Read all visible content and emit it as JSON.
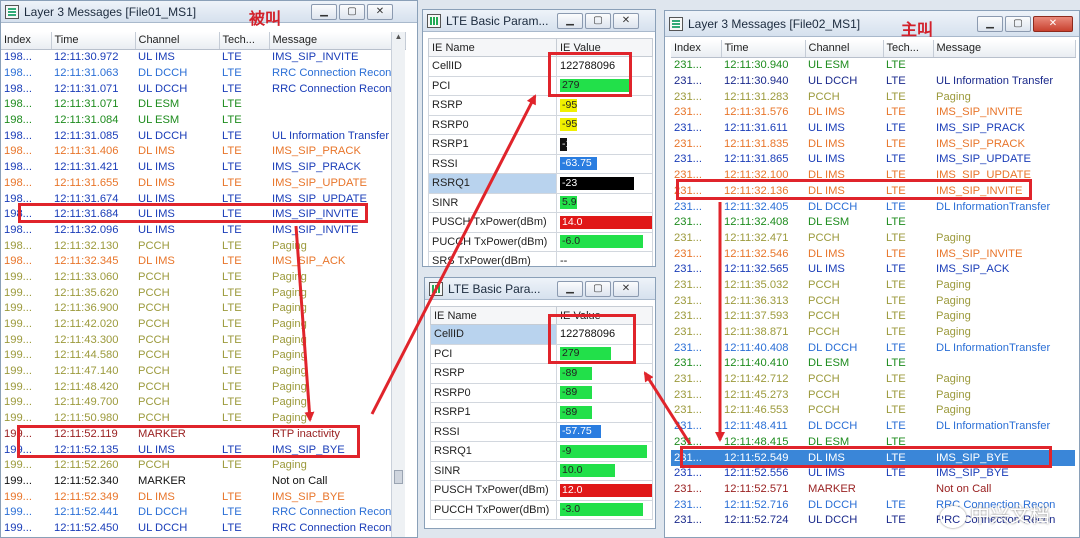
{
  "colors": {
    "accent_red": "#e0242b",
    "selected_row": "#3a86d8"
  },
  "window_left": {
    "title": "Layer 3 Messages [File01_MS1]",
    "note": "被叫",
    "columns": [
      "Index",
      "Time",
      "Channel",
      "Tech...",
      "Message"
    ],
    "rows": [
      {
        "c": "blue",
        "cells": [
          "198...",
          "12:11:30.972",
          "UL IMS",
          "LTE",
          "IMS_SIP_INVITE"
        ]
      },
      {
        "c": "lblue",
        "cells": [
          "198...",
          "12:11:31.063",
          "DL DCCH",
          "LTE",
          "RRC Connection Reconf"
        ]
      },
      {
        "c": "blue",
        "cells": [
          "198...",
          "12:11:31.071",
          "UL DCCH",
          "LTE",
          "RRC Connection Reconf"
        ]
      },
      {
        "c": "green",
        "cells": [
          "198...",
          "12:11:31.071",
          "DL ESM",
          "LTE",
          ""
        ]
      },
      {
        "c": "green",
        "cells": [
          "198...",
          "12:11:31.084",
          "UL ESM",
          "LTE",
          ""
        ]
      },
      {
        "c": "blue",
        "cells": [
          "198...",
          "12:11:31.085",
          "UL DCCH",
          "LTE",
          "UL Information Transfer"
        ]
      },
      {
        "c": "orange",
        "cells": [
          "198...",
          "12:11:31.406",
          "DL IMS",
          "LTE",
          "IMS_SIP_PRACK"
        ]
      },
      {
        "c": "blue",
        "cells": [
          "198...",
          "12:11:31.421",
          "UL IMS",
          "LTE",
          "IMS_SIP_PRACK"
        ]
      },
      {
        "c": "orange",
        "cells": [
          "198...",
          "12:11:31.655",
          "DL IMS",
          "LTE",
          "IMS_SIP_UPDATE"
        ]
      },
      {
        "c": "blue",
        "cells": [
          "198...",
          "12:11:31.674",
          "UL IMS",
          "LTE",
          "IMS_SIP_UPDATE"
        ]
      },
      {
        "c": "blue",
        "cells": [
          "198...",
          "12:11:31.684",
          "UL IMS",
          "LTE",
          "IMS_SIP_INVITE"
        ]
      },
      {
        "c": "blue",
        "cells": [
          "198...",
          "12:11:32.096",
          "UL IMS",
          "LTE",
          "IMS_SIP_INVITE"
        ]
      },
      {
        "c": "olive",
        "cells": [
          "198...",
          "12:11:32.130",
          "PCCH",
          "LTE",
          "Paging"
        ]
      },
      {
        "c": "orange",
        "cells": [
          "198...",
          "12:11:32.345",
          "DL IMS",
          "LTE",
          "IMS_SIP_ACK"
        ]
      },
      {
        "c": "olive",
        "cells": [
          "199...",
          "12:11:33.060",
          "PCCH",
          "LTE",
          "Paging"
        ]
      },
      {
        "c": "olive",
        "cells": [
          "199...",
          "12:11:35.620",
          "PCCH",
          "LTE",
          "Paging"
        ]
      },
      {
        "c": "olive",
        "cells": [
          "199...",
          "12:11:36.900",
          "PCCH",
          "LTE",
          "Paging"
        ]
      },
      {
        "c": "olive",
        "cells": [
          "199...",
          "12:11:42.020",
          "PCCH",
          "LTE",
          "Paging"
        ]
      },
      {
        "c": "olive",
        "cells": [
          "199...",
          "12:11:43.300",
          "PCCH",
          "LTE",
          "Paging"
        ]
      },
      {
        "c": "olive",
        "cells": [
          "199...",
          "12:11:44.580",
          "PCCH",
          "LTE",
          "Paging"
        ]
      },
      {
        "c": "olive",
        "cells": [
          "199...",
          "12:11:47.140",
          "PCCH",
          "LTE",
          "Paging"
        ]
      },
      {
        "c": "olive",
        "cells": [
          "199...",
          "12:11:48.420",
          "PCCH",
          "LTE",
          "Paging"
        ]
      },
      {
        "c": "olive",
        "cells": [
          "199...",
          "12:11:49.700",
          "PCCH",
          "LTE",
          "Paging"
        ]
      },
      {
        "c": "olive",
        "cells": [
          "199...",
          "12:11:50.980",
          "PCCH",
          "LTE",
          "Paging"
        ]
      },
      {
        "c": "darkred",
        "cells": [
          "199...",
          "12:11:52.119",
          "MARKER",
          "",
          "RTP inactivity"
        ]
      },
      {
        "c": "blue",
        "cells": [
          "199...",
          "12:11:52.135",
          "UL IMS",
          "LTE",
          "IMS_SIP_BYE"
        ]
      },
      {
        "c": "olive",
        "cells": [
          "199...",
          "12:11:52.260",
          "PCCH",
          "LTE",
          "Paging"
        ]
      },
      {
        "c": "black",
        "cells": [
          "199...",
          "12:11:52.340",
          "MARKER",
          "",
          "Not on Call"
        ]
      },
      {
        "c": "orange",
        "cells": [
          "199...",
          "12:11:52.349",
          "DL IMS",
          "LTE",
          "IMS_SIP_BYE"
        ]
      },
      {
        "c": "lblue",
        "cells": [
          "199...",
          "12:11:52.441",
          "DL DCCH",
          "LTE",
          "RRC Connection Reconf"
        ]
      },
      {
        "c": "blue",
        "cells": [
          "199...",
          "12:11:52.450",
          "UL DCCH",
          "LTE",
          "RRC Connection Reconf"
        ]
      }
    ]
  },
  "params_top": {
    "title": "LTE Basic Param...",
    "columns": [
      "IE Name",
      "IE Value"
    ],
    "rows": [
      {
        "name": "CellID",
        "value": "122788096",
        "color": "",
        "pct": 0
      },
      {
        "name": "PCI",
        "value": "279",
        "color": "#22e04a",
        "pct": 75
      },
      {
        "name": "RSRP",
        "value": "-95",
        "color": "#f0f000",
        "pct": 18
      },
      {
        "name": "RSRP0",
        "value": "-95",
        "color": "#f0f000",
        "pct": 18
      },
      {
        "name": "RSRP1",
        "value": "-125",
        "color": "#111111",
        "pct": 4
      },
      {
        "name": "RSSI",
        "value": "-63.75",
        "color": "#2a7de0",
        "pct": 40
      },
      {
        "name": "RSRQ1",
        "value": "-23",
        "color": "#000000",
        "pct": 80
      },
      {
        "name": "SINR",
        "value": "5.9",
        "color": "#22e04a",
        "pct": 18
      },
      {
        "name": "PUSCH TxPower(dBm)",
        "value": "14.0",
        "color": "#e01818",
        "pct": 100
      },
      {
        "name": "PUCCH TxPower(dBm)",
        "value": "-6.0",
        "color": "#22e04a",
        "pct": 90
      },
      {
        "name": "SRS TxPower(dBm)",
        "value": "--",
        "color": "",
        "pct": 0
      }
    ]
  },
  "params_bottom": {
    "title": "LTE Basic Para...",
    "columns": [
      "IE Name",
      "IE Value"
    ],
    "rows": [
      {
        "name": "CellID",
        "value": "122788096",
        "color": "",
        "pct": 0
      },
      {
        "name": "PCI",
        "value": "279",
        "color": "#22e04a",
        "pct": 55
      },
      {
        "name": "RSRP",
        "value": "-89",
        "color": "#22e04a",
        "pct": 35
      },
      {
        "name": "RSRP0",
        "value": "-89",
        "color": "#22e04a",
        "pct": 35
      },
      {
        "name": "RSRP1",
        "value": "-89",
        "color": "#22e04a",
        "pct": 35
      },
      {
        "name": "RSSI",
        "value": "-57.75",
        "color": "#2a7de0",
        "pct": 45
      },
      {
        "name": "RSRQ1",
        "value": "-9",
        "color": "#22e04a",
        "pct": 95
      },
      {
        "name": "SINR",
        "value": "10.0",
        "color": "#22e04a",
        "pct": 60
      },
      {
        "name": "PUSCH TxPower(dBm)",
        "value": "12.0",
        "color": "#e01818",
        "pct": 100
      },
      {
        "name": "PUCCH TxPower(dBm)",
        "value": "-3.0",
        "color": "#22e04a",
        "pct": 90
      }
    ]
  },
  "window_right": {
    "title": "Layer 3 Messages [File02_MS1]",
    "note": "主叫",
    "columns": [
      "Index",
      "Time",
      "Channel",
      "Tech...",
      "Message"
    ],
    "rows": [
      {
        "c": "green",
        "cells": [
          "231...",
          "12:11:30.940",
          "UL ESM",
          "LTE",
          ""
        ]
      },
      {
        "c": "navy",
        "cells": [
          "231...",
          "12:11:30.940",
          "UL DCCH",
          "LTE",
          "UL Information Transfer"
        ]
      },
      {
        "c": "olive",
        "cells": [
          "231...",
          "12:11:31.283",
          "PCCH",
          "LTE",
          "Paging"
        ]
      },
      {
        "c": "orange",
        "cells": [
          "231...",
          "12:11:31.576",
          "DL IMS",
          "LTE",
          "IMS_SIP_INVITE"
        ]
      },
      {
        "c": "blue",
        "cells": [
          "231...",
          "12:11:31.611",
          "UL IMS",
          "LTE",
          "IMS_SIP_PRACK"
        ]
      },
      {
        "c": "orange",
        "cells": [
          "231...",
          "12:11:31.835",
          "DL IMS",
          "LTE",
          "IMS_SIP_PRACK"
        ]
      },
      {
        "c": "blue",
        "cells": [
          "231...",
          "12:11:31.865",
          "UL IMS",
          "LTE",
          "IMS_SIP_UPDATE"
        ]
      },
      {
        "c": "orange",
        "cells": [
          "231...",
          "12:11:32.100",
          "DL IMS",
          "LTE",
          "IMS_SIP_UPDATE"
        ]
      },
      {
        "c": "orange",
        "cells": [
          "231...",
          "12:11:32.136",
          "DL IMS",
          "LTE",
          "IMS_SIP_INVITE"
        ]
      },
      {
        "c": "lblue",
        "cells": [
          "231...",
          "12:11:32.405",
          "DL DCCH",
          "LTE",
          "DL InformationTransfer"
        ]
      },
      {
        "c": "green",
        "cells": [
          "231...",
          "12:11:32.408",
          "DL ESM",
          "LTE",
          ""
        ]
      },
      {
        "c": "olive",
        "cells": [
          "231...",
          "12:11:32.471",
          "PCCH",
          "LTE",
          "Paging"
        ]
      },
      {
        "c": "orange",
        "cells": [
          "231...",
          "12:11:32.546",
          "DL IMS",
          "LTE",
          "IMS_SIP_INVITE"
        ]
      },
      {
        "c": "blue",
        "cells": [
          "231...",
          "12:11:32.565",
          "UL IMS",
          "LTE",
          "IMS_SIP_ACK"
        ]
      },
      {
        "c": "olive",
        "cells": [
          "231...",
          "12:11:35.032",
          "PCCH",
          "LTE",
          "Paging"
        ]
      },
      {
        "c": "olive",
        "cells": [
          "231...",
          "12:11:36.313",
          "PCCH",
          "LTE",
          "Paging"
        ]
      },
      {
        "c": "olive",
        "cells": [
          "231...",
          "12:11:37.593",
          "PCCH",
          "LTE",
          "Paging"
        ]
      },
      {
        "c": "olive",
        "cells": [
          "231...",
          "12:11:38.871",
          "PCCH",
          "LTE",
          "Paging"
        ]
      },
      {
        "c": "lblue",
        "cells": [
          "231...",
          "12:11:40.408",
          "DL DCCH",
          "LTE",
          "DL InformationTransfer"
        ]
      },
      {
        "c": "green",
        "cells": [
          "231...",
          "12:11:40.410",
          "DL ESM",
          "LTE",
          ""
        ]
      },
      {
        "c": "olive",
        "cells": [
          "231...",
          "12:11:42.712",
          "PCCH",
          "LTE",
          "Paging"
        ]
      },
      {
        "c": "olive",
        "cells": [
          "231...",
          "12:11:45.273",
          "PCCH",
          "LTE",
          "Paging"
        ]
      },
      {
        "c": "olive",
        "cells": [
          "231...",
          "12:11:46.553",
          "PCCH",
          "LTE",
          "Paging"
        ]
      },
      {
        "c": "lblue",
        "cells": [
          "231...",
          "12:11:48.411",
          "DL DCCH",
          "LTE",
          "DL InformationTransfer"
        ]
      },
      {
        "c": "green",
        "cells": [
          "231...",
          "12:11:48.415",
          "DL ESM",
          "LTE",
          ""
        ]
      },
      {
        "c": "sel",
        "cells": [
          "231...",
          "12:11:52.549",
          "DL IMS",
          "LTE",
          "IMS_SIP_BYE"
        ]
      },
      {
        "c": "blue",
        "cells": [
          "231...",
          "12:11:52.556",
          "UL IMS",
          "LTE",
          "IMS_SIP_BYE"
        ]
      },
      {
        "c": "darkred",
        "cells": [
          "231...",
          "12:11:52.571",
          "MARKER",
          "",
          "Not on Call"
        ]
      },
      {
        "c": "lblue",
        "cells": [
          "231...",
          "12:11:52.716",
          "DL DCCH",
          "LTE",
          "RRC Connection Recon"
        ]
      },
      {
        "c": "navy",
        "cells": [
          "231...",
          "12:11:52.724",
          "UL DCCH",
          "LTE",
          "RRC Connection Recon"
        ]
      }
    ]
  },
  "watermark": "中兴文档"
}
